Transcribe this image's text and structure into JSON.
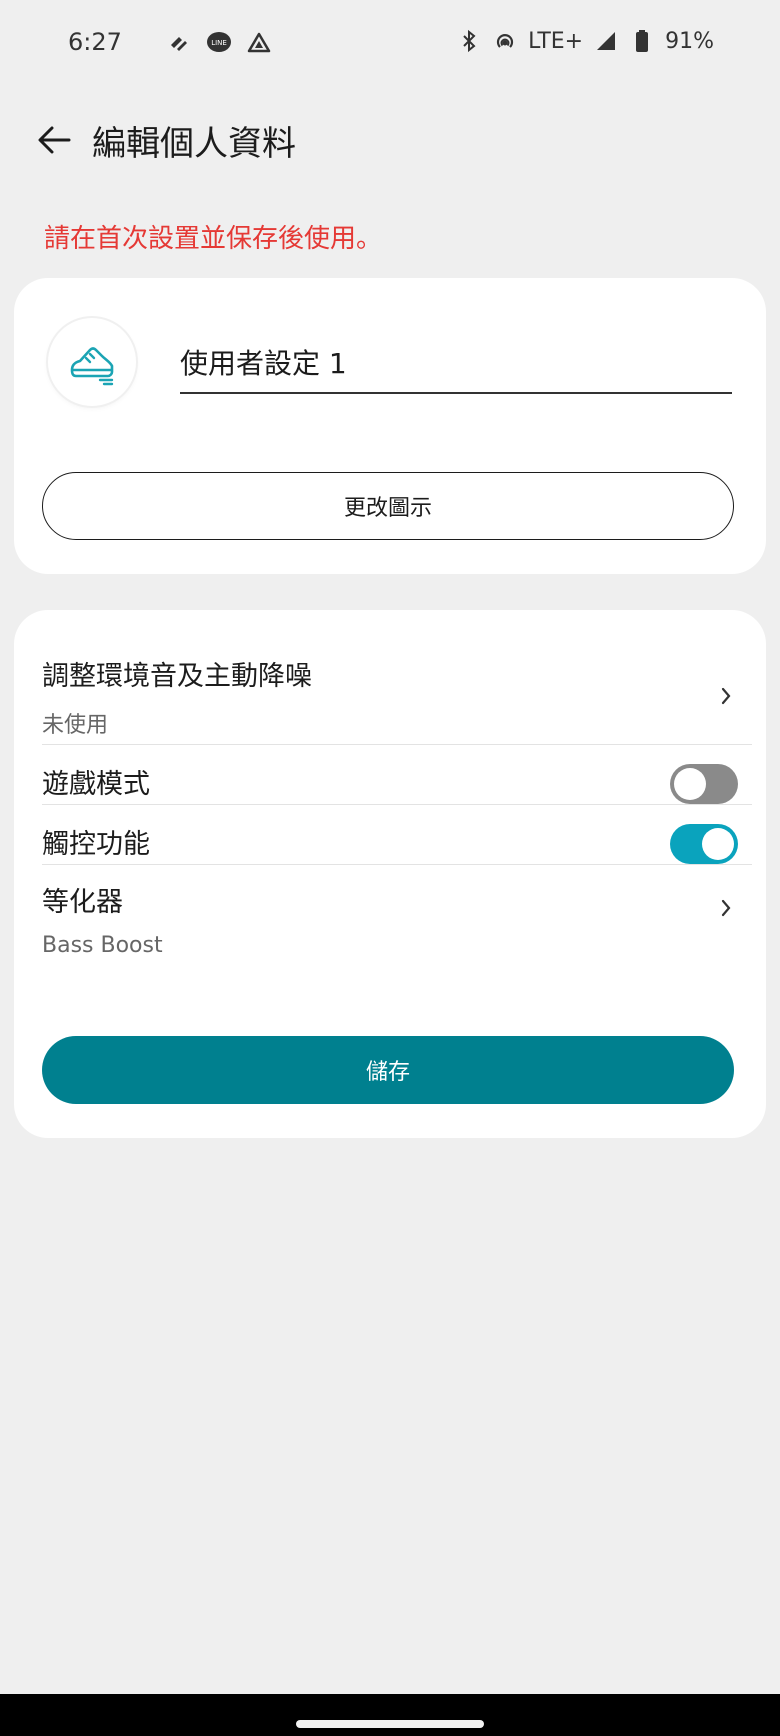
{
  "status_bar": {
    "time": "6:27",
    "network": "LTE+",
    "battery": "91%",
    "left_icons": [
      "pinwheel-icon",
      "line-app-icon",
      "drive-icon"
    ],
    "right_icons": [
      "bluetooth-icon",
      "hotspot-icon",
      "signal-icon",
      "battery-icon"
    ]
  },
  "header": {
    "title": "編輯個人資料",
    "back_icon": "arrow-left-icon"
  },
  "warning": "請在首次設置並保存後使用。",
  "profile": {
    "avatar_icon": "running-shoe-icon",
    "name_value": "使用者設定 1",
    "change_icon_label": "更改圖示",
    "accent_color": "#1ba4b4"
  },
  "settings": {
    "ambient": {
      "title": "調整環境音及主動降噪",
      "subtitle": "未使用"
    },
    "game_mode": {
      "title": "遊戲模式",
      "enabled": false
    },
    "touch": {
      "title": "觸控功能",
      "enabled": true
    },
    "equalizer": {
      "title": "等化器",
      "subtitle": "Bass Boost"
    },
    "save_label": "儲存"
  },
  "colors": {
    "warning": "#e53935",
    "primary": "#00808f",
    "toggle_on": "#0aa3bd",
    "toggle_off": "#8a8a8a",
    "background": "#efefef"
  }
}
